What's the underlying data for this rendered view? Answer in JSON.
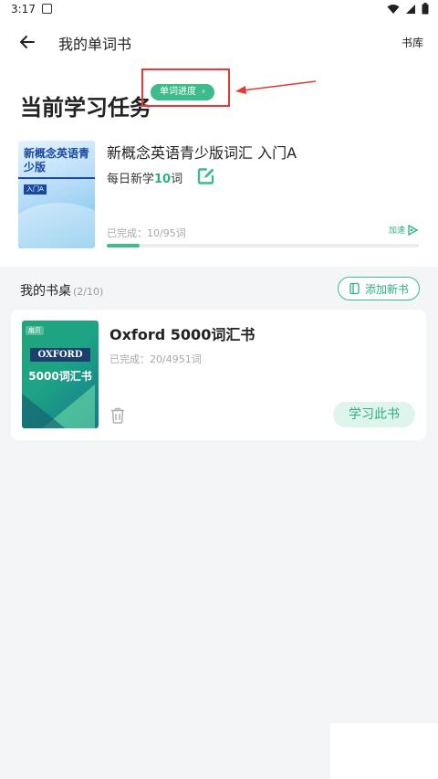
{
  "status_bar": {
    "time": "3:17"
  },
  "header": {
    "title": "我的单词书",
    "library_link": "书库"
  },
  "current_task": {
    "section_title": "当前学习任务",
    "progress_button": "单词进度",
    "book": {
      "cover_title": "新概念英语青少版",
      "cover_badge": "入门A",
      "name": "新概念英语青少版词汇 入门A",
      "daily_prefix": "每日新学",
      "daily_count": "10",
      "daily_suffix": "词",
      "completed_text": "已完成：10/95词",
      "progress_fraction": 0.105,
      "speed_label": "加速"
    }
  },
  "desk": {
    "label": "我的书桌",
    "count": "(2/10)",
    "add_button": "添加新书",
    "books": [
      {
        "cover_brand": "扇贝",
        "cover_word": "OXFORD",
        "cover_sub": "5000词汇书",
        "title": "Oxford 5000词汇书",
        "completed_text": "已完成：20/4951词",
        "study_button": "学习此书"
      }
    ]
  },
  "colors": {
    "accent": "#3dbb8a",
    "accent_text": "#2bb07f",
    "annotation": "#e53935"
  }
}
